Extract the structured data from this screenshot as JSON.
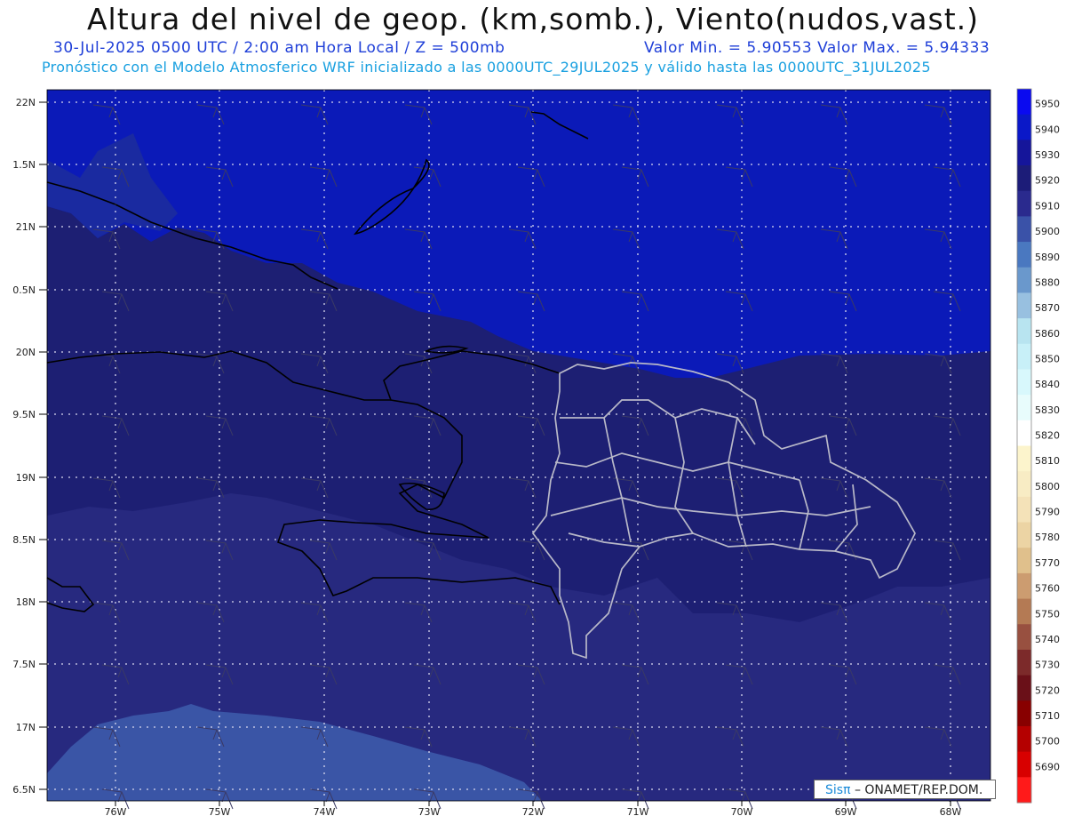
{
  "title": "Altura del nivel de geop. (km,somb.), Viento(nudos,vast.)",
  "subtitle": {
    "date_line": "30-Jul-2025   0500 UTC / 2:00 am Hora Local / Z = 500mb",
    "minmax": "Valor Min. = 5.90553  Valor Max. = 5.94333",
    "model_line": "Pronóstico con el Modelo Atmosferico WRF inicializado a las 0000UTC_29JUL2025 y válido hasta las  0000UTC_31JUL2025"
  },
  "credit": {
    "logo": "Sisπ",
    "text": " – ONAMET/REP.DOM."
  },
  "axes": {
    "lat_labels": [
      "22N",
      "1.5N",
      "21N",
      "0.5N",
      "20N",
      "9.5N",
      "19N",
      "8.5N",
      "18N",
      "7.5N",
      "17N",
      "6.5N"
    ],
    "lon_labels": [
      "76W",
      "75W",
      "74W",
      "73W",
      "72W",
      "71W",
      "70W",
      "69W",
      "68W"
    ]
  },
  "colorbar": {
    "labels": [
      "5950",
      "5940",
      "5930",
      "5920",
      "5910",
      "5900",
      "5890",
      "5880",
      "5870",
      "5860",
      "5850",
      "5840",
      "5830",
      "5820",
      "5810",
      "5800",
      "5790",
      "5780",
      "5770",
      "5760",
      "5750",
      "5740",
      "5730",
      "5720",
      "5710",
      "5700",
      "5690"
    ],
    "colors": [
      "#0a0af0",
      "#0a18c8",
      "#15159a",
      "#1c1c78",
      "#2a2a8e",
      "#3a52a8",
      "#4a78c0",
      "#6a98cc",
      "#98c0e0",
      "#b8e4f0",
      "#c8f0f8",
      "#d8f8fc",
      "#e8fcfc",
      "#ffffff",
      "#fcf4cc",
      "#f8ecc4",
      "#f4e2b8",
      "#ecd4a4",
      "#e0c08c",
      "#cc9c70",
      "#b47a54",
      "#985040",
      "#7c2a2a",
      "#6a1018",
      "#880000",
      "#b40000",
      "#d80000",
      "#ff1a1a"
    ]
  },
  "colors": {
    "deep_blue": "#0b1ab8",
    "band_dark": "#1d1f73",
    "band_mid": "#27297f",
    "band_light": "#3a55a6",
    "coast": "#000000",
    "provinces": "#b8b8c8"
  }
}
